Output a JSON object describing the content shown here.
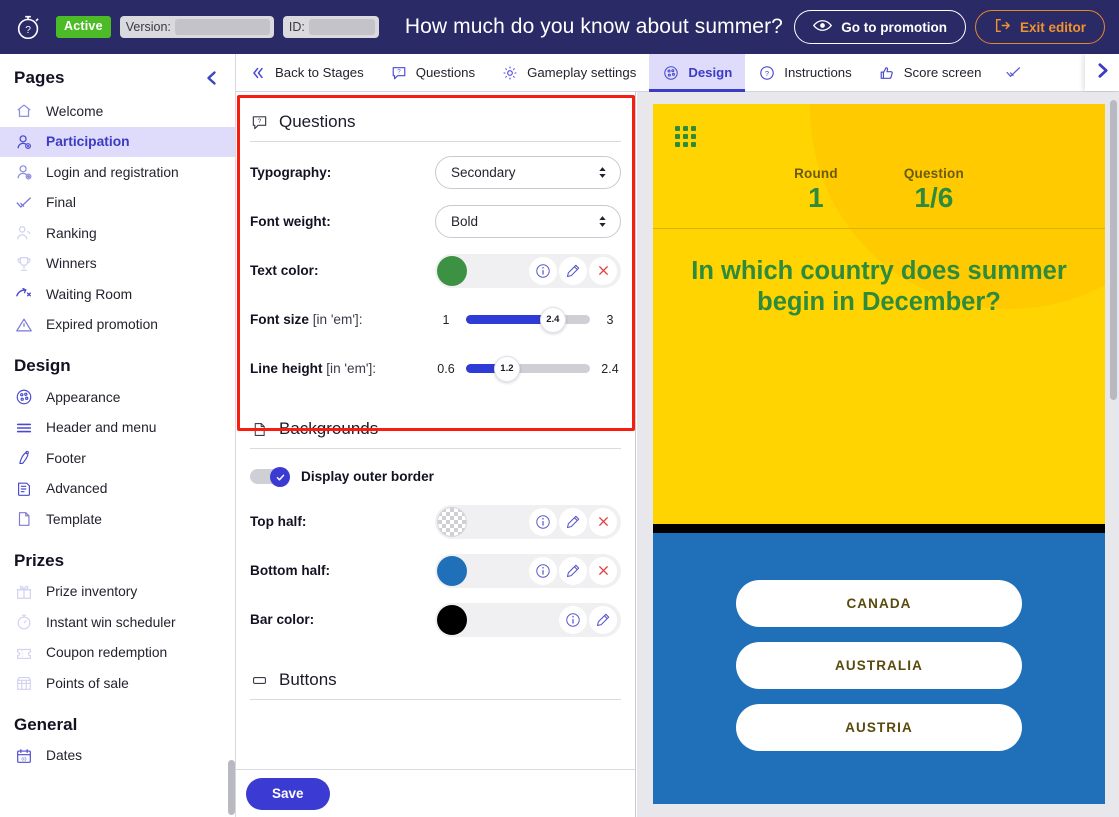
{
  "topbar": {
    "logo_icon": "stopwatch-question-icon",
    "status_badge": "Active",
    "version_label": "Version:",
    "id_label": "ID:",
    "promotion_title": "How much do you know about summer?",
    "go_to_promotion": "Go to promotion",
    "exit_editor": "Exit editor",
    "bg_color": "#2a2a66",
    "badge_color": "#4cbb26",
    "exit_color": "#f0922f"
  },
  "sidebar": {
    "pages_title": "Pages",
    "pages": [
      {
        "label": "Welcome",
        "icon": "home-icon"
      },
      {
        "label": "Participation",
        "icon": "user-add-icon"
      },
      {
        "label": "Login and registration",
        "icon": "user-login-icon"
      },
      {
        "label": "Final",
        "icon": "check-icon"
      },
      {
        "label": "Ranking",
        "icon": "podium-icon"
      },
      {
        "label": "Winners",
        "icon": "trophy-icon"
      },
      {
        "label": "Waiting Room",
        "icon": "hourglass-arrow-icon"
      },
      {
        "label": "Expired promotion",
        "icon": "warning-triangle-icon"
      }
    ],
    "design_title": "Design",
    "design": [
      {
        "label": "Appearance",
        "icon": "palette-icon"
      },
      {
        "label": "Header and menu",
        "icon": "menu-lines-icon"
      },
      {
        "label": "Footer",
        "icon": "footer-icon"
      },
      {
        "label": "Advanced",
        "icon": "document-code-icon"
      },
      {
        "label": "Template",
        "icon": "page-icon"
      }
    ],
    "prizes_title": "Prizes",
    "prizes": [
      {
        "label": "Prize inventory",
        "icon": "gift-icon"
      },
      {
        "label": "Instant win scheduler",
        "icon": "stopwatch-icon"
      },
      {
        "label": "Coupon redemption",
        "icon": "coupon-icon"
      },
      {
        "label": "Points of sale",
        "icon": "store-icon"
      }
    ],
    "general_title": "General",
    "general": [
      {
        "label": "Dates",
        "icon": "calendar-icon"
      }
    ],
    "collapse_icon": "chevron-left-icon",
    "active_item": "Participation"
  },
  "tabs": [
    {
      "label": "Back to Stages",
      "icon": "double-chevron-left-icon",
      "active": false
    },
    {
      "label": "Questions",
      "icon": "question-bubble-icon",
      "active": false
    },
    {
      "label": "Gameplay settings",
      "icon": "gear-icon",
      "active": false
    },
    {
      "label": "Design",
      "icon": "palette-icon",
      "active": true
    },
    {
      "label": "Instructions",
      "icon": "question-circle-icon",
      "active": false
    },
    {
      "label": "Score screen",
      "icon": "thumbs-up-icon",
      "active": false
    },
    {
      "label": "",
      "icon": "check-icon",
      "active": false
    }
  ],
  "tab_next_icon": "chevron-right-icon",
  "panel": {
    "questions": {
      "title": "Questions",
      "icon": "question-bubble-icon",
      "typography": {
        "label": "Typography:",
        "value": "Secondary"
      },
      "font_weight": {
        "label": "Font weight:",
        "value": "Bold"
      },
      "text_color": {
        "label": "Text color:",
        "swatch": "#3d9142",
        "buttons": [
          "info-icon",
          "pencil-icon",
          "close-icon"
        ]
      },
      "font_size": {
        "label": "Font size",
        "unit": "[in 'em']:",
        "min": "1",
        "max": "3",
        "value": "2.4",
        "percent": 70
      },
      "line_height": {
        "label": "Line height",
        "unit": "[in 'em']:",
        "min": "0.6",
        "max": "2.4",
        "value": "1.2",
        "percent": 33
      }
    },
    "backgrounds": {
      "title": "Backgrounds",
      "icon": "page-icon",
      "display_outer_border": {
        "label": "Display outer border",
        "checked": true
      },
      "top_half": {
        "label": "Top half:",
        "swatch": "transparent",
        "buttons": [
          "info-icon",
          "pencil-icon",
          "close-icon"
        ]
      },
      "bottom_half": {
        "label": "Bottom half:",
        "swatch": "#1f70b8",
        "buttons": [
          "info-icon",
          "pencil-icon",
          "close-icon"
        ]
      },
      "bar_color": {
        "label": "Bar color:",
        "swatch": "#000000",
        "buttons": [
          "info-icon",
          "pencil-icon"
        ]
      }
    },
    "buttons": {
      "title": "Buttons",
      "icon": "button-icon"
    },
    "save_label": "Save"
  },
  "preview": {
    "grid_icon": "grid-dots-icon",
    "round_label": "Round",
    "round_value": "1",
    "question_label": "Question",
    "question_value": "1/6",
    "question_text": "In which country does summer begin in December?",
    "answers": [
      "CANADA",
      "AUSTRALIA",
      "AUSTRIA"
    ],
    "top_bg": "#ffd400",
    "bar_color": "#000000",
    "bottom_bg": "#1f70b8",
    "text_color": "#2e8b3d",
    "label_color": "#6b5a11",
    "answer_text_color": "#5a4a0d"
  }
}
